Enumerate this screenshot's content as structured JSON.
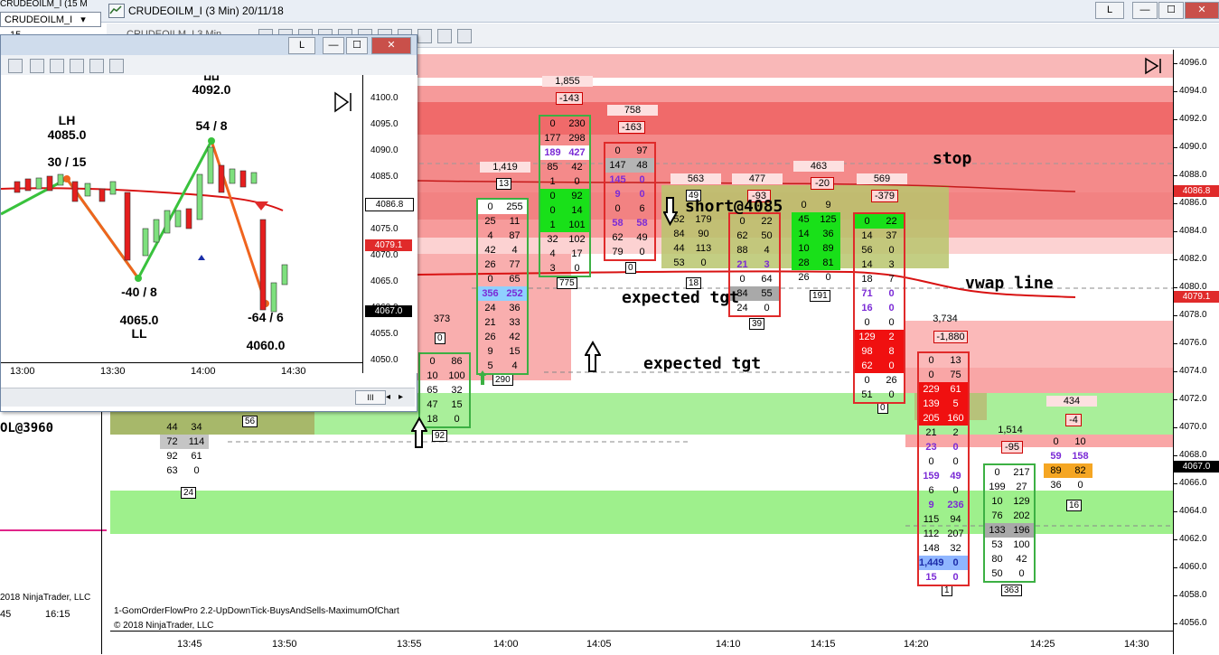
{
  "window": {
    "title": "CRUDEOILM_I (3 Min)  20/11/18",
    "back_tab_title": "CRUDEOILM_I (15 M",
    "instrument_selector": "CRUDEOILM_I",
    "instrument_selector_suffix": "15",
    "toolbar_ghost": "CRUDEOILM_I    3 Min",
    "btn_l": "L",
    "btn_min": "—",
    "btn_max": "☐",
    "btn_close": "✕"
  },
  "chart": {
    "y_ticks": [
      "4096.0",
      "4094.0",
      "4092.0",
      "4090.0",
      "4088.0",
      "4086.0",
      "4084.0",
      "4082.0",
      "4080.0",
      "4078.0",
      "4076.0",
      "4074.0",
      "4072.0",
      "4070.0",
      "4068.0",
      "4066.0",
      "4064.0",
      "4062.0",
      "4060.0",
      "4058.0",
      "4056.0"
    ],
    "x_ticks": [
      "13:45",
      "13:50",
      "13:55",
      "14:00",
      "14:05",
      "14:10",
      "14:15",
      "14:20",
      "14:25",
      "14:30"
    ],
    "price_labels": {
      "upper_ref": "4086.8",
      "vwap": "4079.1",
      "last": "4067.0"
    },
    "price_label_colors": {
      "upper_ref": "#e02a2a",
      "vwap": "#e02a2a",
      "last": "#000000"
    },
    "series_label": "CRUDEOILM_I (3 Min)",
    "indicator_label": "1-GomOrderFlowPro 2.2-UpDownTick-BuysAndSells-MaximumOfChart",
    "copyright": "© 2018 NinjaTrader, LLC",
    "annotations": {
      "stop": "stop",
      "short": "short@4085",
      "vwap": "vwap line",
      "tgt1": "expected tgt",
      "tgt2": "expected tgt",
      "left_partial": "OL@3960"
    },
    "bar_totals": [
      "373",
      "1,419",
      "1,855",
      "758",
      "563",
      "477",
      "463",
      "569",
      "3,734",
      "1,514",
      "434"
    ],
    "bar_deltas": [
      "-143",
      "-163",
      "-93",
      "-20",
      "-379",
      "-1,880",
      "-95",
      "-4"
    ],
    "bar_counts": [
      "24",
      "56",
      "0",
      "92",
      "13",
      "290",
      "775",
      "0",
      "18",
      "49",
      "39",
      "191",
      "0",
      "1",
      "363",
      "16"
    ],
    "footprints": {
      "b1": [
        [
          "44",
          "34"
        ],
        [
          "72",
          "114"
        ],
        [
          "92",
          "61"
        ],
        [
          "63",
          "0"
        ]
      ],
      "b2": [
        [
          "0",
          "86"
        ],
        [
          "10",
          "100"
        ],
        [
          "65",
          "32"
        ],
        [
          "47",
          "15"
        ],
        [
          "18",
          "0"
        ]
      ],
      "b3": [
        [
          "0",
          "255"
        ],
        [
          "25",
          "11"
        ],
        [
          "4",
          "87"
        ],
        [
          "42",
          "4"
        ],
        [
          "26",
          "77"
        ],
        [
          "0",
          "65"
        ],
        [
          "356",
          "252"
        ],
        [
          "24",
          "36"
        ],
        [
          "21",
          "33"
        ],
        [
          "26",
          "42"
        ],
        [
          "9",
          "15"
        ],
        [
          "5",
          "4"
        ]
      ],
      "b4": [
        [
          "0",
          "230"
        ],
        [
          "177",
          "298"
        ],
        [
          "189",
          "427"
        ],
        [
          "85",
          "42"
        ],
        [
          "1",
          "0"
        ],
        [
          "0",
          "92"
        ],
        [
          "0",
          "14"
        ],
        [
          "1",
          "101"
        ],
        [
          "32",
          "102"
        ],
        [
          "4",
          "17"
        ],
        [
          "3",
          "0"
        ]
      ],
      "b5": [
        [
          "0",
          "97"
        ],
        [
          "147",
          "48"
        ],
        [
          "145",
          "0"
        ],
        [
          "9",
          "0"
        ],
        [
          "0",
          "6"
        ],
        [
          "58",
          "58"
        ],
        [
          "62",
          "49"
        ],
        [
          "79",
          "0"
        ]
      ],
      "b6": [
        [
          "52",
          "179"
        ],
        [
          "84",
          "90"
        ],
        [
          "44",
          "113"
        ],
        [
          "53",
          "0"
        ]
      ],
      "b7": [
        [
          "0",
          "22"
        ],
        [
          "62",
          "50"
        ],
        [
          "88",
          "4"
        ],
        [
          "21",
          "3"
        ],
        [
          "0",
          "64"
        ],
        [
          "84",
          "55"
        ],
        [
          "24",
          "0"
        ]
      ],
      "b8": [
        [
          "0",
          "9"
        ],
        [
          "45",
          "125"
        ],
        [
          "14",
          "36"
        ],
        [
          "10",
          "89"
        ],
        [
          "28",
          "81"
        ],
        [
          "26",
          "0"
        ]
      ],
      "b9": [
        [
          "0",
          "22"
        ],
        [
          "14",
          "37"
        ],
        [
          "56",
          "0"
        ],
        [
          "14",
          "3"
        ],
        [
          "18",
          "7"
        ],
        [
          "71",
          "0"
        ],
        [
          "16",
          "0"
        ],
        [
          "0",
          "0"
        ],
        [
          "129",
          "2"
        ],
        [
          "98",
          "8"
        ],
        [
          "62",
          "0"
        ],
        [
          "0",
          "26"
        ],
        [
          "51",
          "0"
        ]
      ],
      "b10": [
        [
          "0",
          "13"
        ],
        [
          "0",
          "75"
        ],
        [
          "229",
          "61"
        ],
        [
          "139",
          "5"
        ],
        [
          "205",
          "160"
        ],
        [
          "21",
          "2"
        ],
        [
          "23",
          "0"
        ],
        [
          "0",
          "0"
        ],
        [
          "159",
          "49"
        ],
        [
          "6",
          "0"
        ],
        [
          "9",
          "236"
        ],
        [
          "115",
          "94"
        ],
        [
          "112",
          "207"
        ],
        [
          "148",
          "32"
        ],
        [
          "1,449",
          "0"
        ],
        [
          "15",
          "0"
        ]
      ],
      "b11": [
        [
          "0",
          "217"
        ],
        [
          "199",
          "27"
        ],
        [
          "10",
          "129"
        ],
        [
          "76",
          "202"
        ],
        [
          "133",
          "196"
        ],
        [
          "53",
          "100"
        ],
        [
          "80",
          "42"
        ],
        [
          "50",
          "0"
        ]
      ],
      "b12": [
        [
          "0",
          "10"
        ],
        [
          "59",
          "158"
        ],
        [
          "89",
          "82"
        ],
        [
          "36",
          "0"
        ]
      ]
    }
  },
  "mini_chart": {
    "title_btn_l": "L",
    "y_ticks": [
      "4100.0",
      "4095.0",
      "4090.0",
      "4085.0",
      "4080.0",
      "4075.0",
      "4070.0",
      "4065.0",
      "4060.0",
      "4055.0",
      "4050.0"
    ],
    "x_ticks": [
      "13:00",
      "13:30",
      "14:00",
      "14:30"
    ],
    "price_labels": {
      "upper": "4086.8",
      "vwap": "4079.1",
      "last": "4067.0"
    },
    "labels": {
      "hh_partial": "HH",
      "hh_price": "4092.0",
      "hh_ratio": "54 / 8",
      "lh": "LH",
      "lh_price": "4085.0",
      "lh_ratio": "30 / 15",
      "ll_ratio": "-40 / 8",
      "ll_price": "4065.0",
      "ll": "LL",
      "last_ratio": "-64 / 6",
      "last_price": "4060.0"
    },
    "lower_left": {
      "partial_x1": "45",
      "partial_x2": "16:15",
      "copyright": "2018 NinjaTrader, LLC",
      "scroll_btn": "III"
    }
  }
}
